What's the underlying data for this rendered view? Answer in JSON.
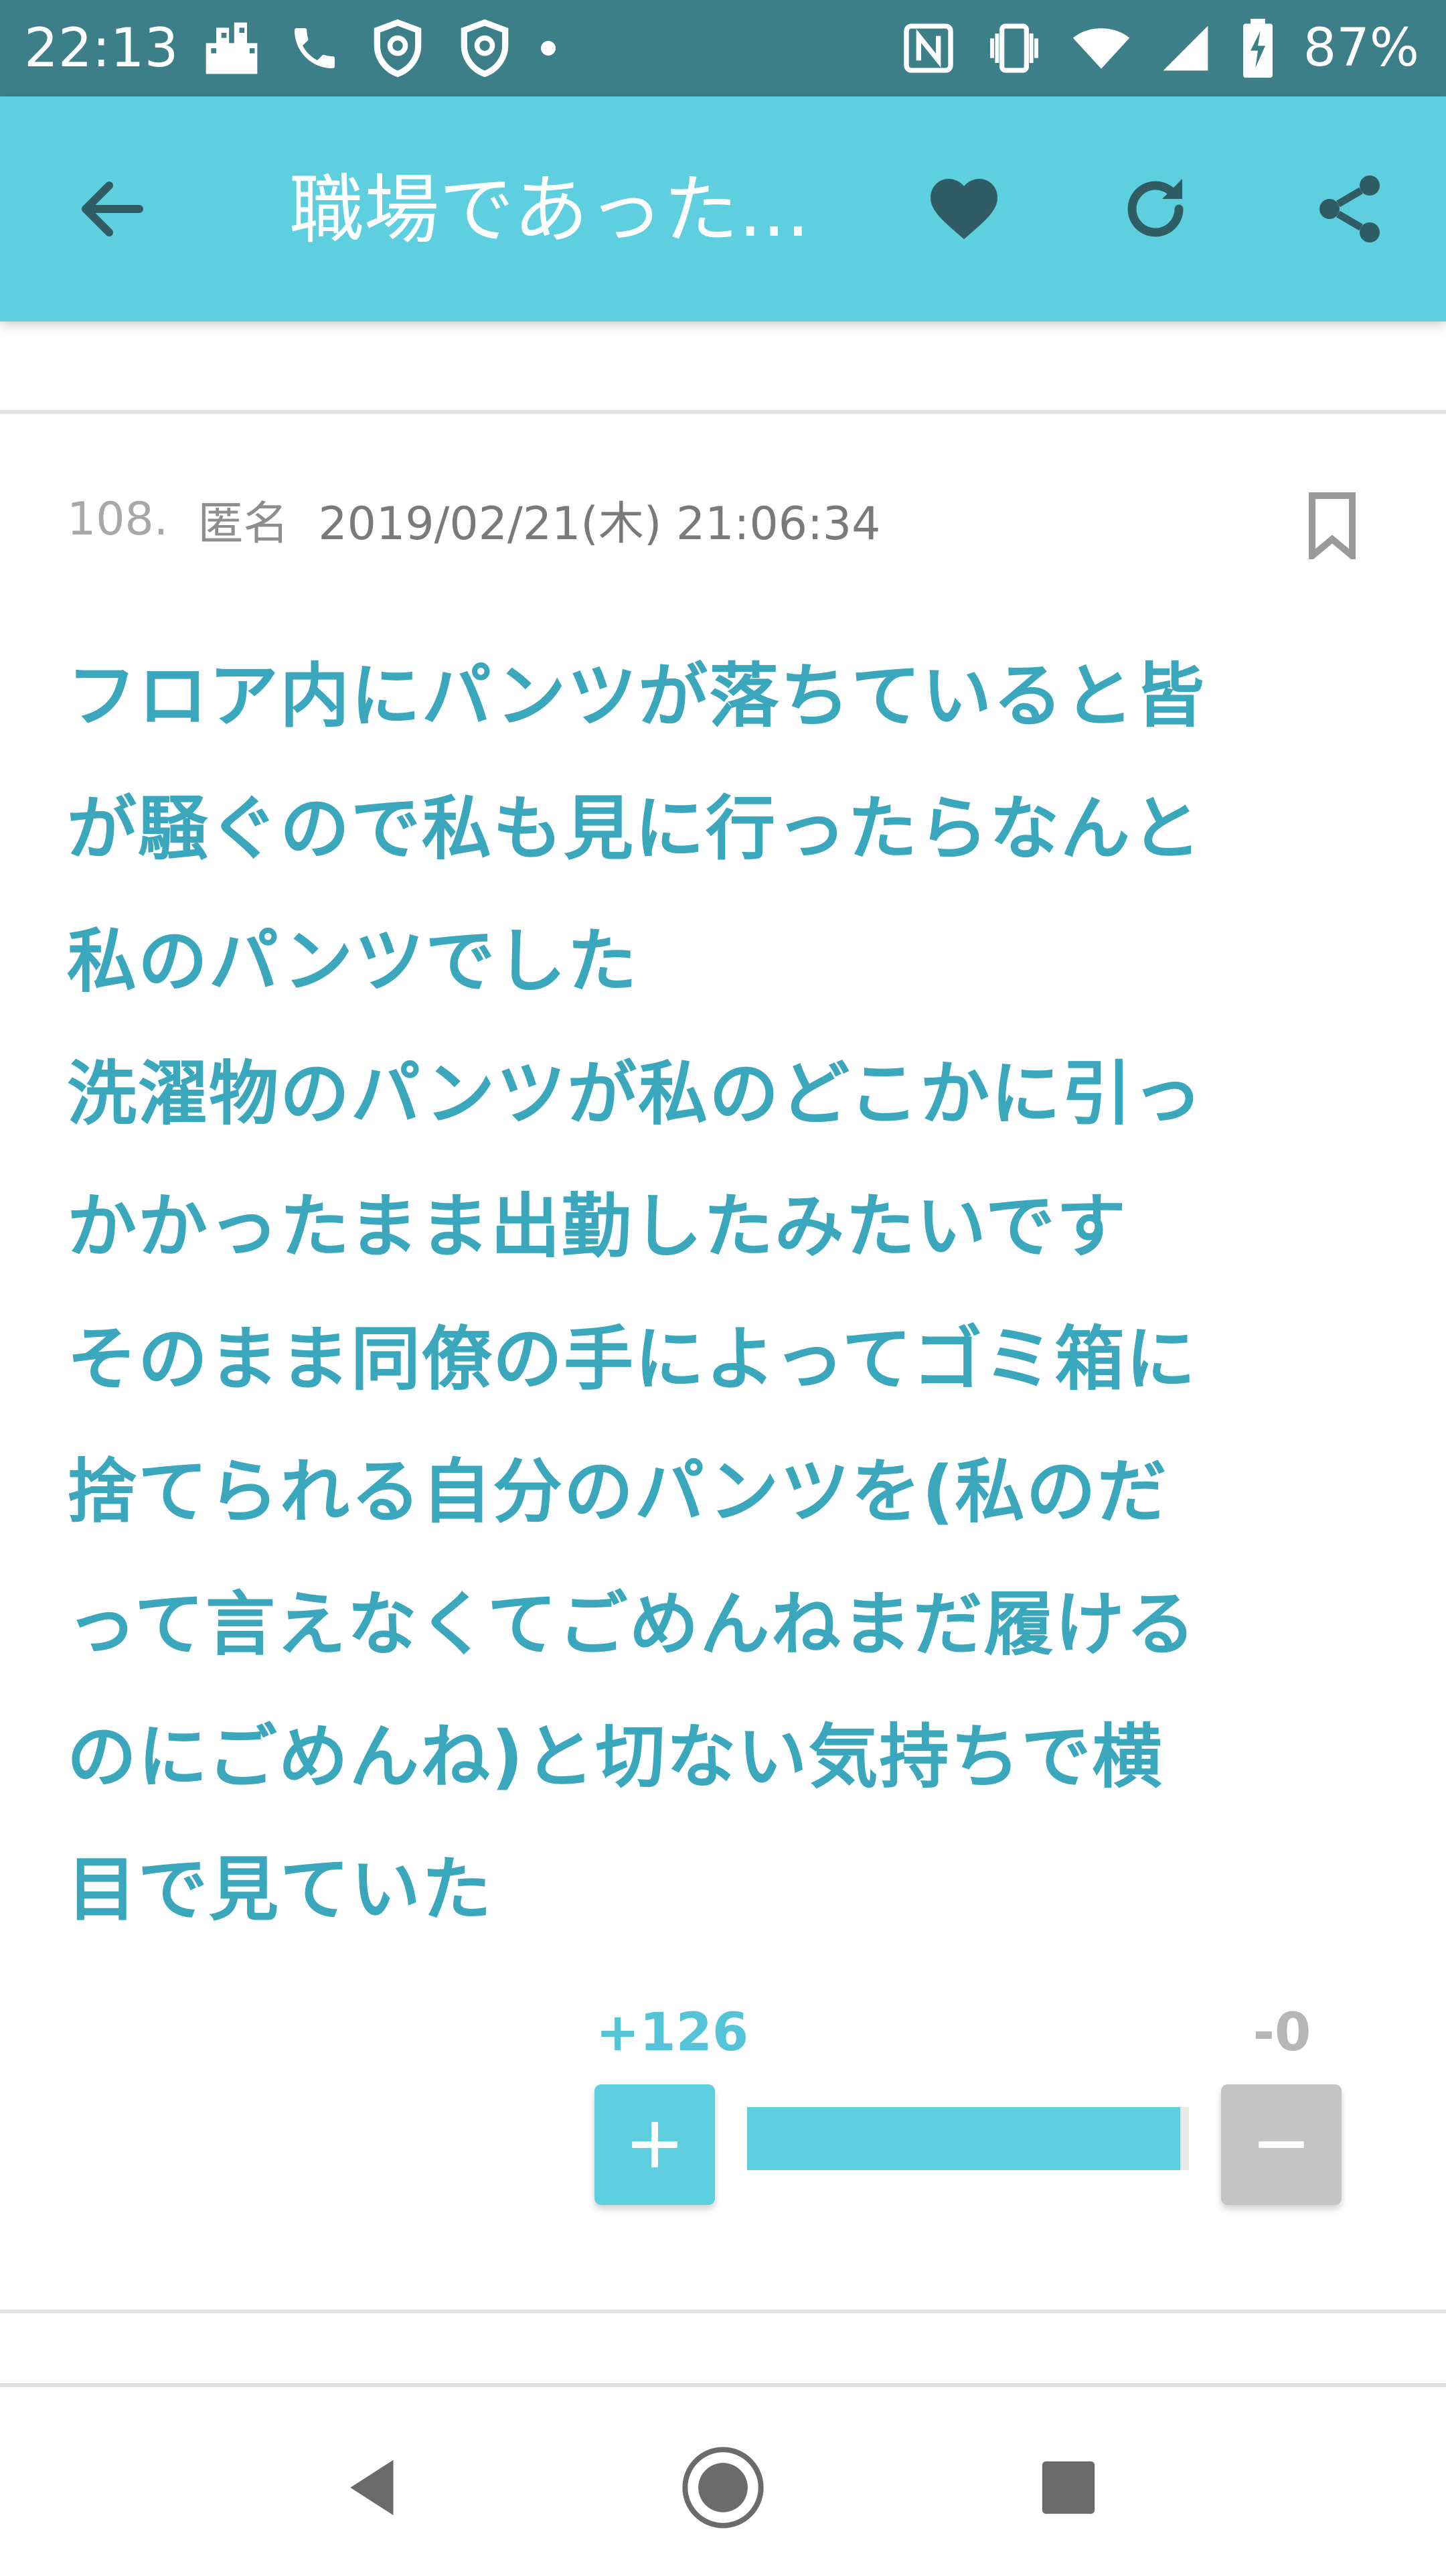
{
  "status_bar": {
    "time": "22:13",
    "battery": "87%",
    "left_icons": [
      "city-icon",
      "wifi-calling-icon",
      "shield-icon",
      "shield-icon"
    ],
    "right_icons": [
      "nfc-icon",
      "vibrate-icon",
      "wifi-icon",
      "signal-icon",
      "battery-icon"
    ]
  },
  "app_bar": {
    "title": "職場であった...",
    "back_icon": "arrow-left-icon",
    "favorite_icon": "heart-icon",
    "refresh_icon": "refresh-icon",
    "share_icon": "share-icon"
  },
  "post": {
    "number": "108.",
    "author": "匿名",
    "datetime": "2019/02/21(木) 21:06:34",
    "bookmark_icon": "bookmark-icon",
    "body": "フロア内にパンツが落ちていると皆\nが騒ぐので私も見に行ったらなんと\n私のパンツでした\n洗濯物のパンツが私のどこかに引っ\nかかったまま出勤したみたいです\nそのまま同僚の手によってゴミ箱に\n捨てられる自分のパンツを(私のだ\nって言えなくてごめんねまだ履ける\nのにごめんね)と切ない気持ちで横\n目で見ていた",
    "votes": {
      "plus_label": "+126",
      "minus_label": "-0",
      "plus": 126,
      "minus": 0,
      "plus_fraction": 0.98
    }
  },
  "colors": {
    "status_bar": "#3d7f88",
    "app_bar": "#5ecfdf",
    "body_text": "#3aa7bc",
    "minus_button": "#c4c4c4"
  },
  "nav_bar": {
    "back": "triangle-back-icon",
    "home": "circle-home-icon",
    "recents": "square-recents-icon"
  }
}
